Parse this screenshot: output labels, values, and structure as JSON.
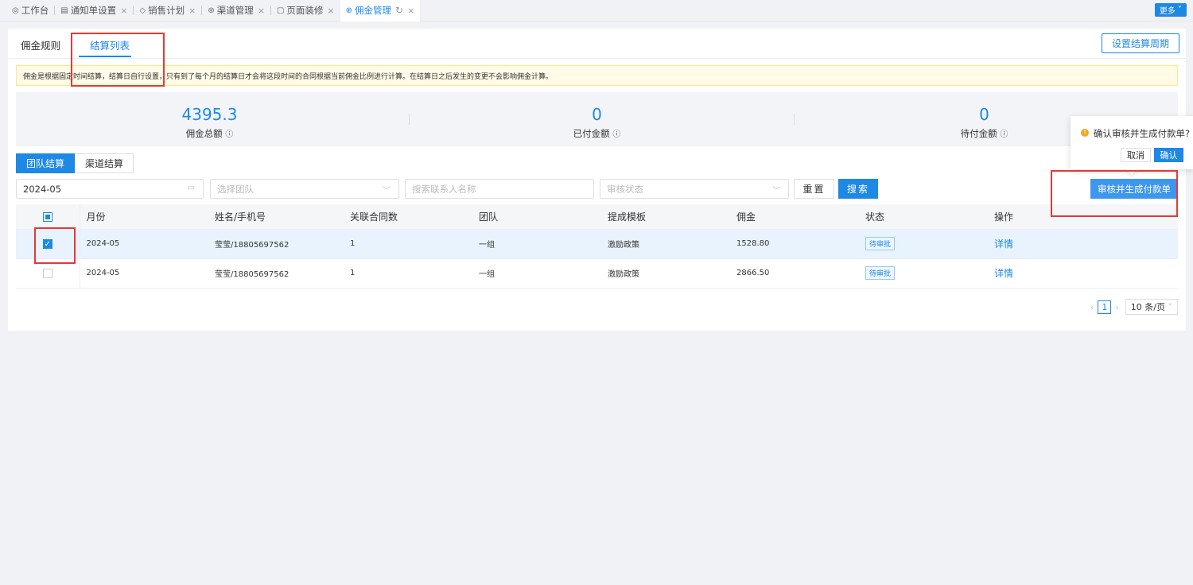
{
  "tabs": [
    {
      "label": "工作台",
      "icon": "dashboard-icon",
      "closable": false
    },
    {
      "label": "通知单设置",
      "icon": "notice-icon",
      "closable": true
    },
    {
      "label": "销售计划",
      "icon": "tag-icon",
      "closable": true
    },
    {
      "label": "渠道管理",
      "icon": "channel-icon",
      "closable": true
    },
    {
      "label": "页面装修",
      "icon": "page-icon",
      "closable": true
    },
    {
      "label": "佣金管理",
      "icon": "commission-icon",
      "closable": true,
      "active": true
    }
  ],
  "more_label": "更多",
  "subtabs": {
    "rules": "佣金规则",
    "list": "结算列表"
  },
  "period_button": "设置结算周期",
  "notice": "佣金是根据固定时间结算，结算日自行设置，只有到了每个月的结算日才会将这段时间的合同根据当前佣金比例进行计算。在结算日之后发生的变更不会影响佣金计算。",
  "stats": [
    {
      "value": "4395.3",
      "label": "佣金总额"
    },
    {
      "value": "0",
      "label": "已付金额"
    },
    {
      "value": "0",
      "label": "待付金额"
    }
  ],
  "segments": {
    "team": "团队结算",
    "channel": "渠道结算"
  },
  "filters": {
    "month": "2024-05",
    "team_placeholder": "选择团队",
    "contact_placeholder": "搜索联系人名称",
    "status_placeholder": "审核状态"
  },
  "buttons": {
    "reset": "重置",
    "search": "搜索",
    "approve": "审核并生成付款单"
  },
  "table": {
    "headers": [
      "月份",
      "姓名/手机号",
      "关联合同数",
      "团队",
      "提成模板",
      "佣金",
      "状态",
      "操作"
    ],
    "rows": [
      {
        "month": "2024-05",
        "name": "莹莹/18805697562",
        "contracts": "1",
        "team": "一组",
        "template": "激励政策",
        "commission": "1528.80",
        "status": "待审批",
        "action": "详情",
        "selected": true
      },
      {
        "month": "2024-05",
        "name": "莹莹/18805697562",
        "contracts": "1",
        "team": "一组",
        "template": "激励政策",
        "commission": "2866.50",
        "status": "待审批",
        "action": "详情",
        "selected": false
      }
    ]
  },
  "pagination": {
    "current": "1",
    "page_size": "10 条/页"
  },
  "popconfirm": {
    "message": "确认审核并生成付款单?",
    "cancel": "取消",
    "confirm": "确认"
  },
  "colors": {
    "primary": "#1e88e5",
    "annotation": "#e53935",
    "warning": "#f5a623"
  }
}
